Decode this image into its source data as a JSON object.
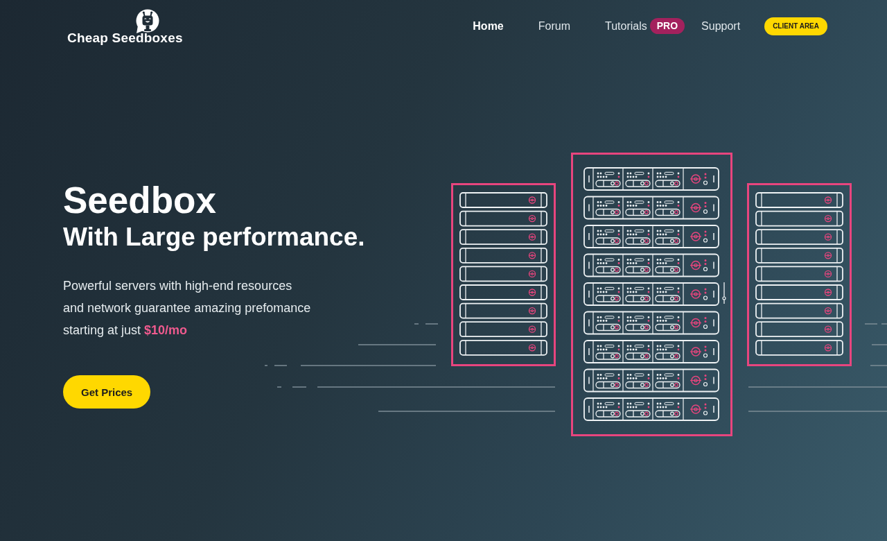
{
  "logo": {
    "text": "Cheap Seedboxes"
  },
  "nav": {
    "items": [
      {
        "label": "Home",
        "selected": true
      },
      {
        "label": "Forum",
        "selected": false
      },
      {
        "label": "Tutorials",
        "selected": false,
        "badge": "PRO"
      },
      {
        "label": "Support",
        "selected": false
      }
    ],
    "button": "CLIENT AREA"
  },
  "hero": {
    "title": "Seedbox",
    "subtitle": "With Large performance.",
    "description": "Powerful servers with high-end resources\nand network guarantee amazing prefomance\nstarting at just **$10/mo**",
    "button": "Get Prices"
  }
}
